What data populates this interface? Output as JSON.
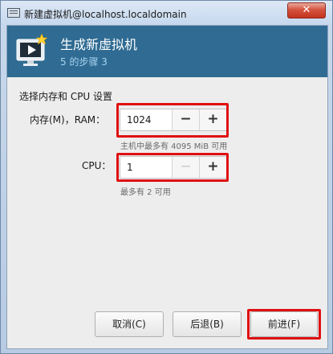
{
  "window": {
    "title": "新建虚拟机@localhost.localdomain",
    "close_label": "✕"
  },
  "banner": {
    "title": "生成新虚拟机",
    "step": "5 的步骤 3",
    "icon": "monitor-star-icon"
  },
  "section": {
    "label": "选择内存和 CPU 设置"
  },
  "memory": {
    "label": "内存(M)，RAM：",
    "value": "1024",
    "decrement": "−",
    "increment": "+",
    "hint": "主机中最多有 4095 MiB 可用"
  },
  "cpu": {
    "label": "CPU：",
    "value": "1",
    "decrement": "−",
    "increment": "+",
    "hint": "最多有 2 可用"
  },
  "buttons": {
    "cancel": "取消(C)",
    "back": "后退(B)",
    "forward": "前进(F)"
  },
  "colors": {
    "banner": "#2f6b92",
    "highlight": "#e01010",
    "close": "#c3331e"
  }
}
